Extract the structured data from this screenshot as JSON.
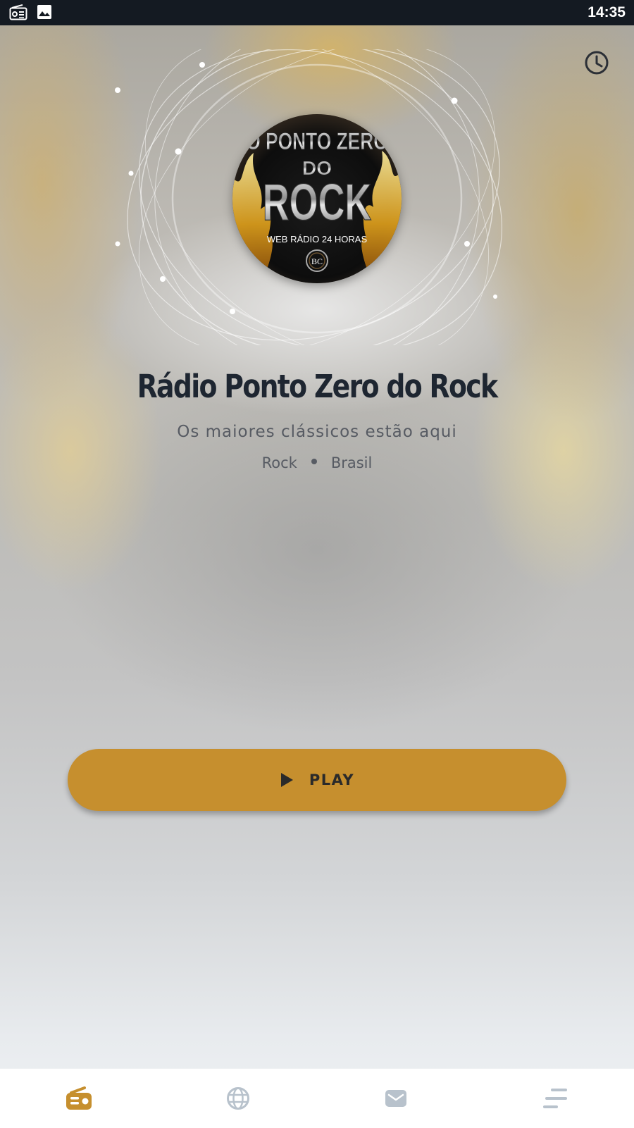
{
  "status_bar": {
    "time": "14:35",
    "icons": [
      "radio-icon",
      "image-icon"
    ]
  },
  "header": {
    "history_icon": "clock-icon"
  },
  "station": {
    "cover_text": {
      "line1": "O PONTO ZERO",
      "line2": "DO",
      "line3": "ROCK",
      "line4": "WEB RÁDIO 24 HORAS",
      "badge": "BC"
    },
    "name": "Rádio Ponto Zero do Rock",
    "description": "Os maiores clássicos estão aqui",
    "genre": "Rock",
    "country": "Brasil"
  },
  "player": {
    "play_label": "PLAY",
    "play_icon": "play-icon"
  },
  "bottom_nav": {
    "items": [
      {
        "icon": "radio-icon",
        "active": true
      },
      {
        "icon": "globe-icon",
        "active": false
      },
      {
        "icon": "mail-icon",
        "active": false
      },
      {
        "icon": "menu-icon",
        "active": false
      }
    ]
  },
  "colors": {
    "accent": "#c68f2e",
    "nav_inactive": "#b8c2cc",
    "status_bar": "#141a22",
    "title": "#1e2631"
  }
}
